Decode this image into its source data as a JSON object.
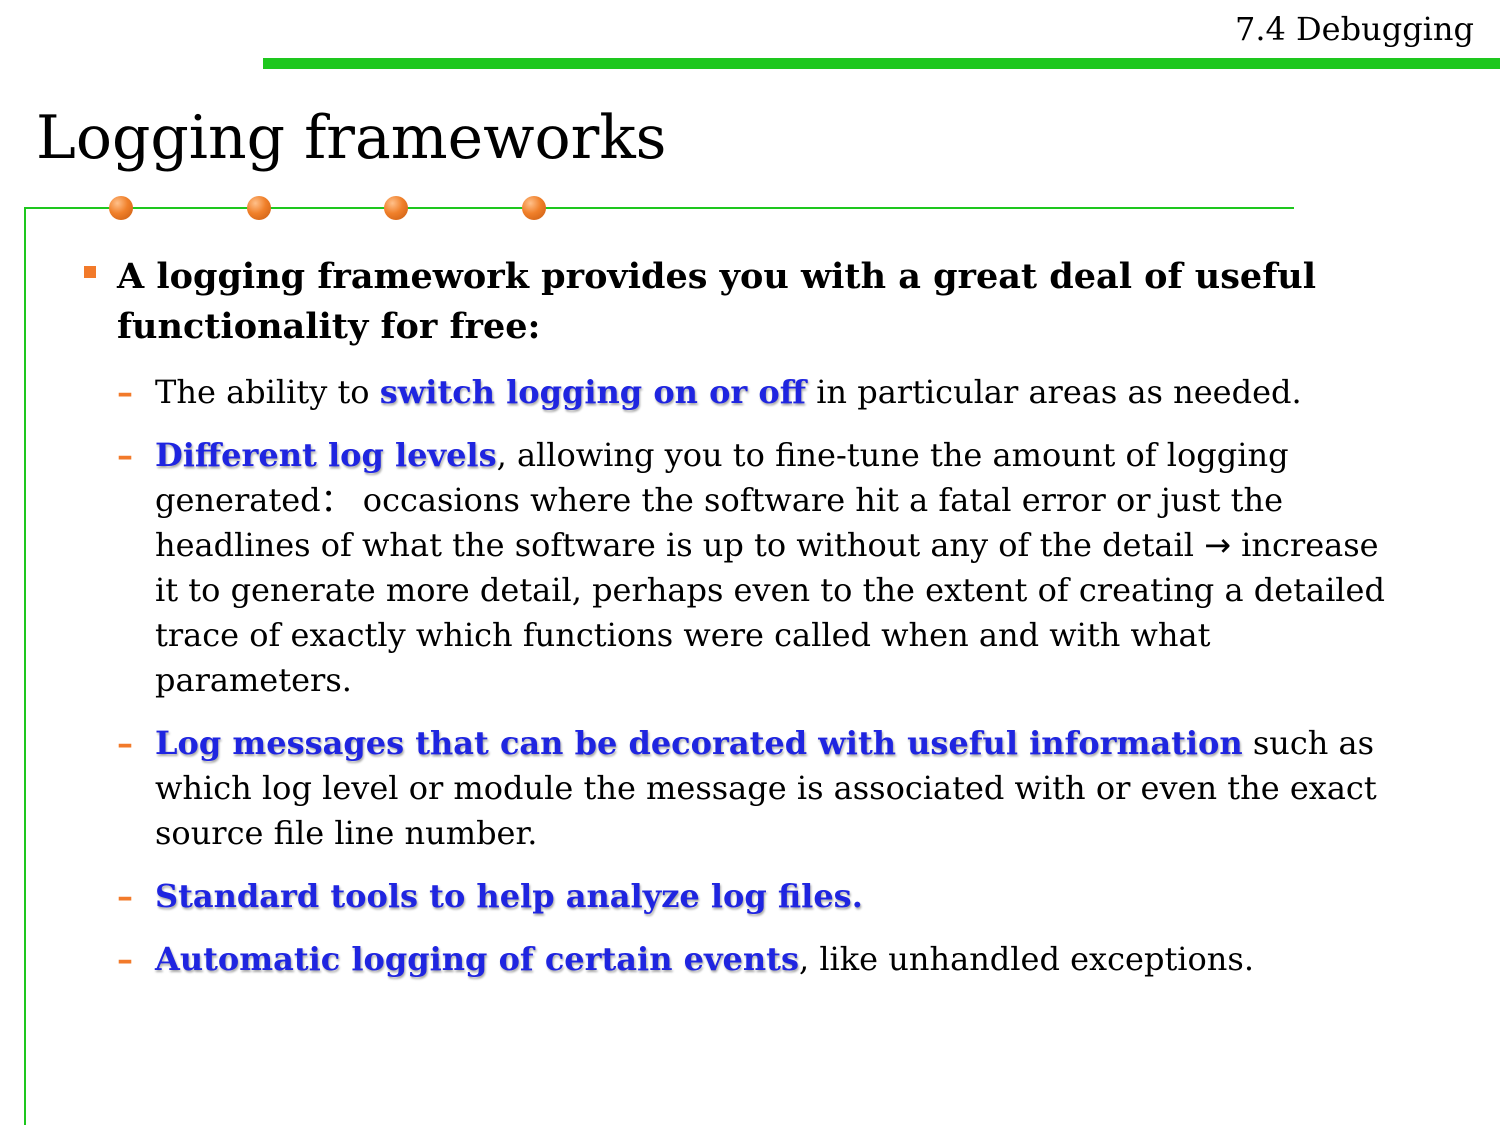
{
  "header": {
    "section": "7.4 Debugging",
    "title": "Logging frameworks"
  },
  "main_point": "A logging framework provides you with a great deal of useful functionality for free:",
  "items": [
    {
      "pre": "The ability to ",
      "highlight": "switch logging on or off",
      "post": " in particular areas as needed."
    },
    {
      "highlight": "Different log levels",
      "post": ", allowing you to fine-tune the amount of logging generated： occasions where the software hit a fatal error or just the headlines of what the software is up to without any of the detail ",
      "arrow": "→",
      "post2": " increase it to generate more detail, perhaps even to the extent of creating a detailed trace of exactly which functions were called when and with what parameters."
    },
    {
      "highlight": "Log messages that can be decorated with useful information",
      "post": " such as which log level or module the message is associated with or even the exact source file line number."
    },
    {
      "highlight": "Standard tools to help analyze log files."
    },
    {
      "highlight": "Automatic logging of certain events",
      "post": ", like unhandled exceptions."
    }
  ],
  "dash": "–",
  "colors": {
    "accent_green": "#1ec71e",
    "bullet_orange": "#f27a2a",
    "highlight_blue": "#1f25e0"
  }
}
